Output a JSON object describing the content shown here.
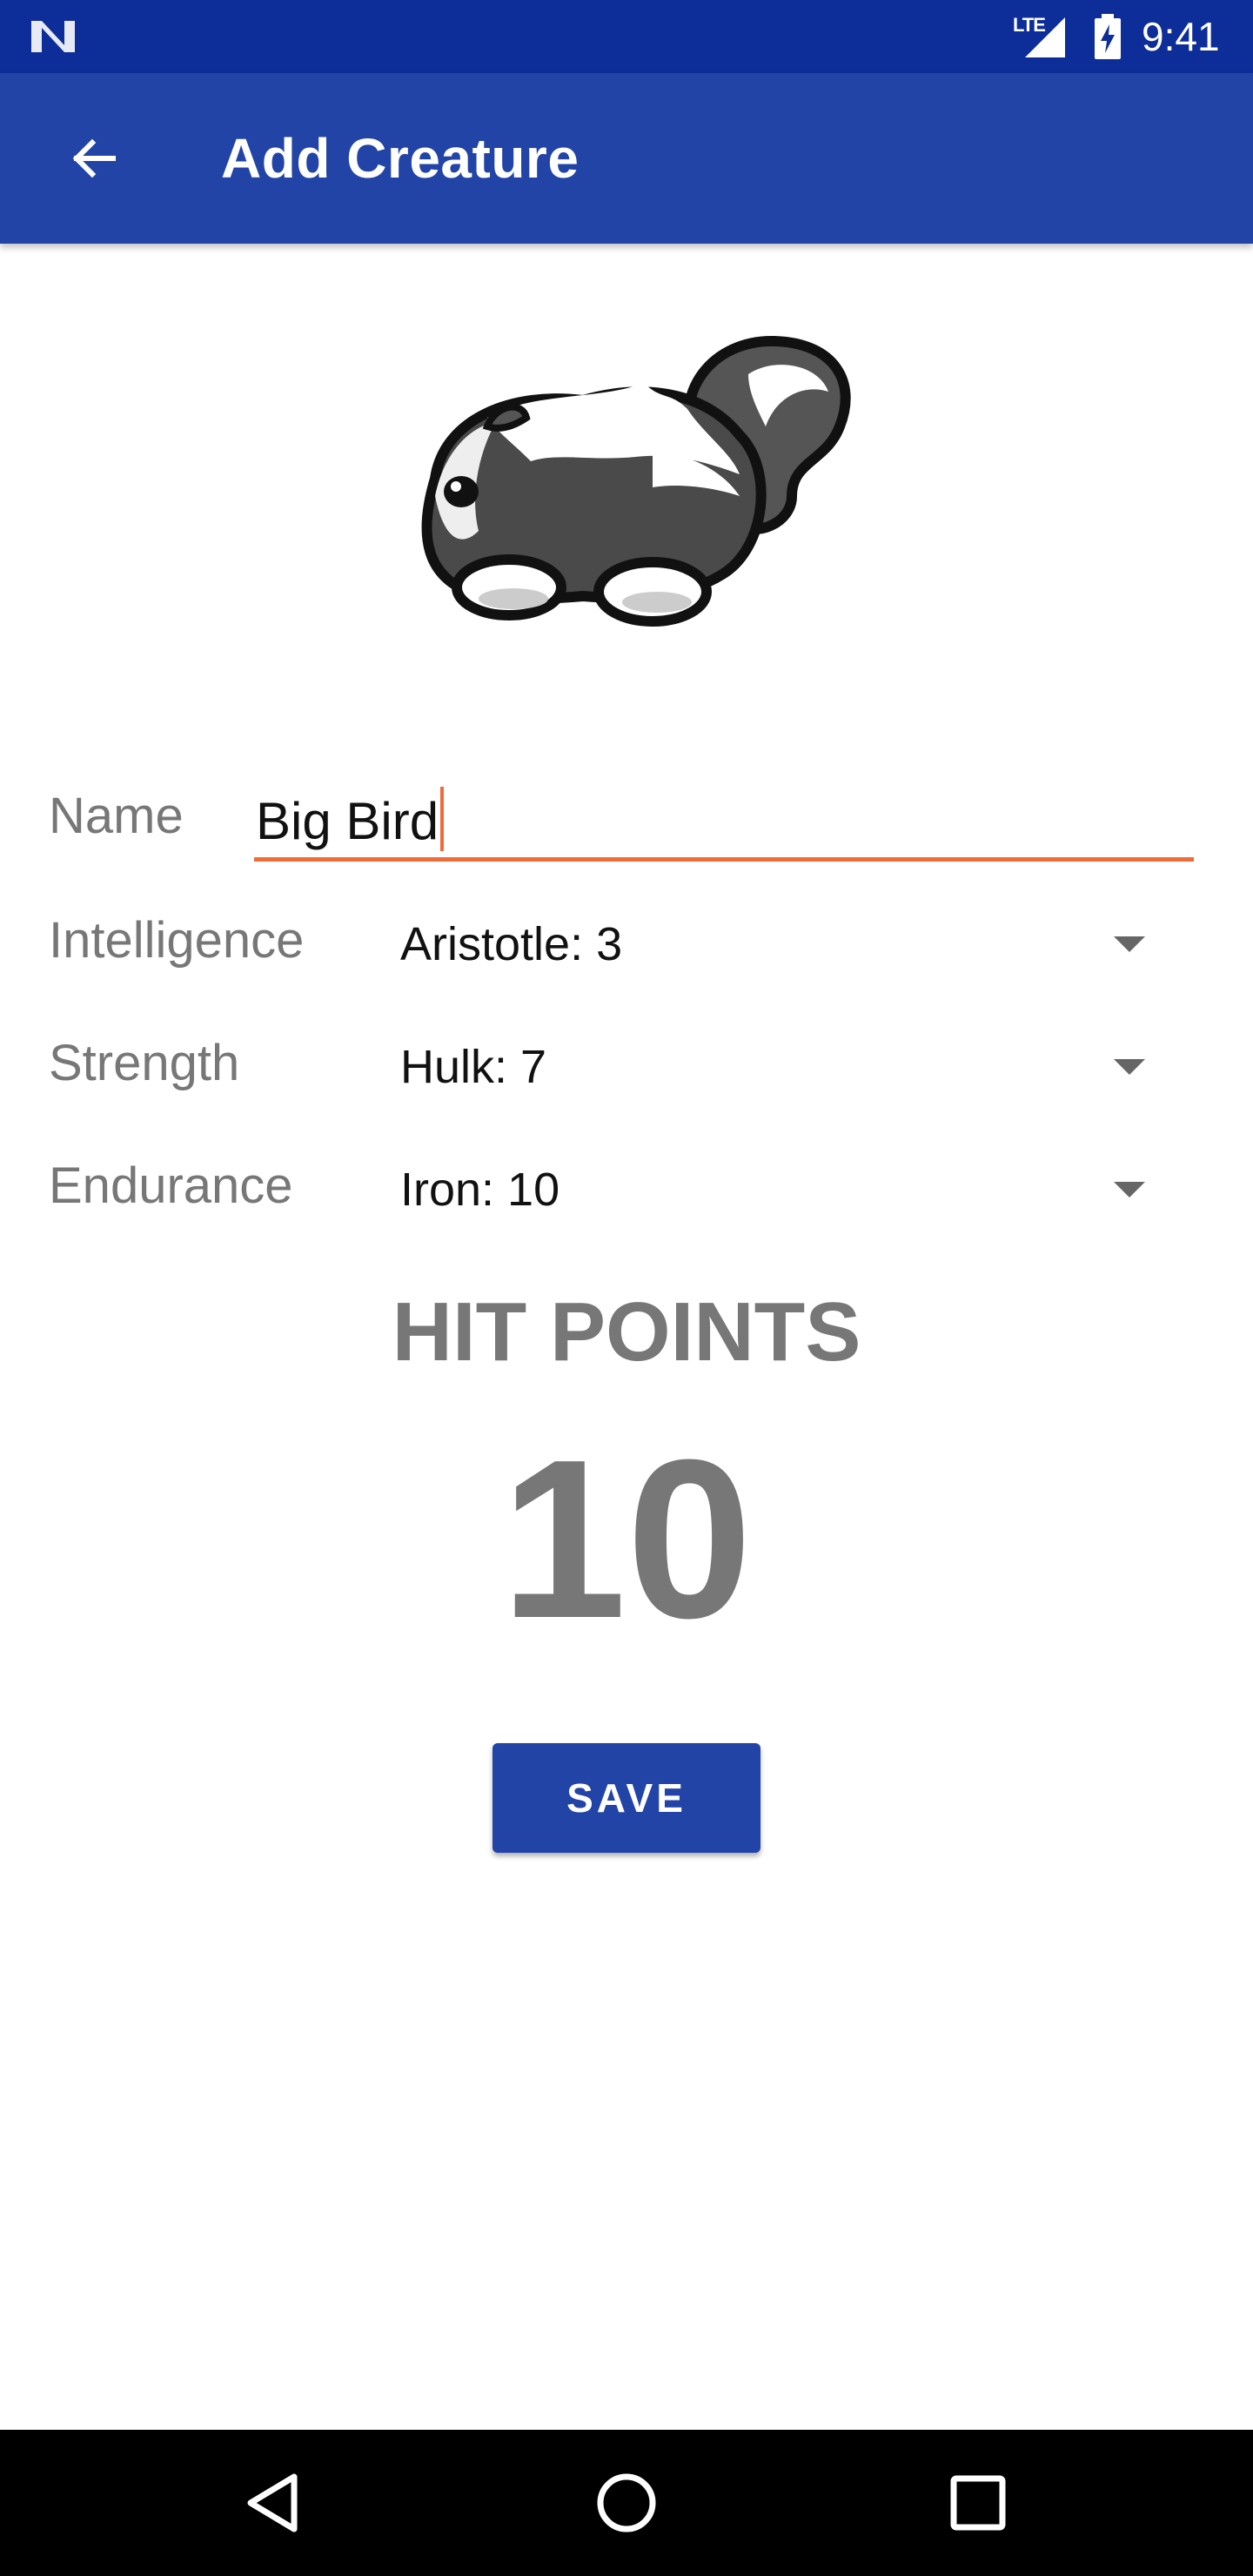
{
  "status_bar": {
    "network_label": "LTE",
    "time": "9:41",
    "icons": [
      "n-logo-icon",
      "signal-icon",
      "battery-charging-icon"
    ]
  },
  "app_bar": {
    "title": "Add Creature",
    "back_icon": "arrow-left-icon"
  },
  "creature": {
    "image_icon": "skunk-creature-icon"
  },
  "form": {
    "name": {
      "label": "Name",
      "value": "Big Bird"
    },
    "intelligence": {
      "label": "Intelligence",
      "selected": "Aristotle: 3"
    },
    "strength": {
      "label": "Strength",
      "selected": "Hulk: 7"
    },
    "endurance": {
      "label": "Endurance",
      "selected": "Iron: 10"
    }
  },
  "hit_points": {
    "label": "HIT POINTS",
    "value": "10"
  },
  "save_button": {
    "label": "SAVE"
  },
  "nav_bar": {
    "icons": [
      "nav-back-icon",
      "nav-home-icon",
      "nav-recents-icon"
    ]
  },
  "colors": {
    "status_bar": "#0d2e99",
    "primary": "#2244a6",
    "accent": "#ef6c3a",
    "label_gray": "#777777"
  }
}
